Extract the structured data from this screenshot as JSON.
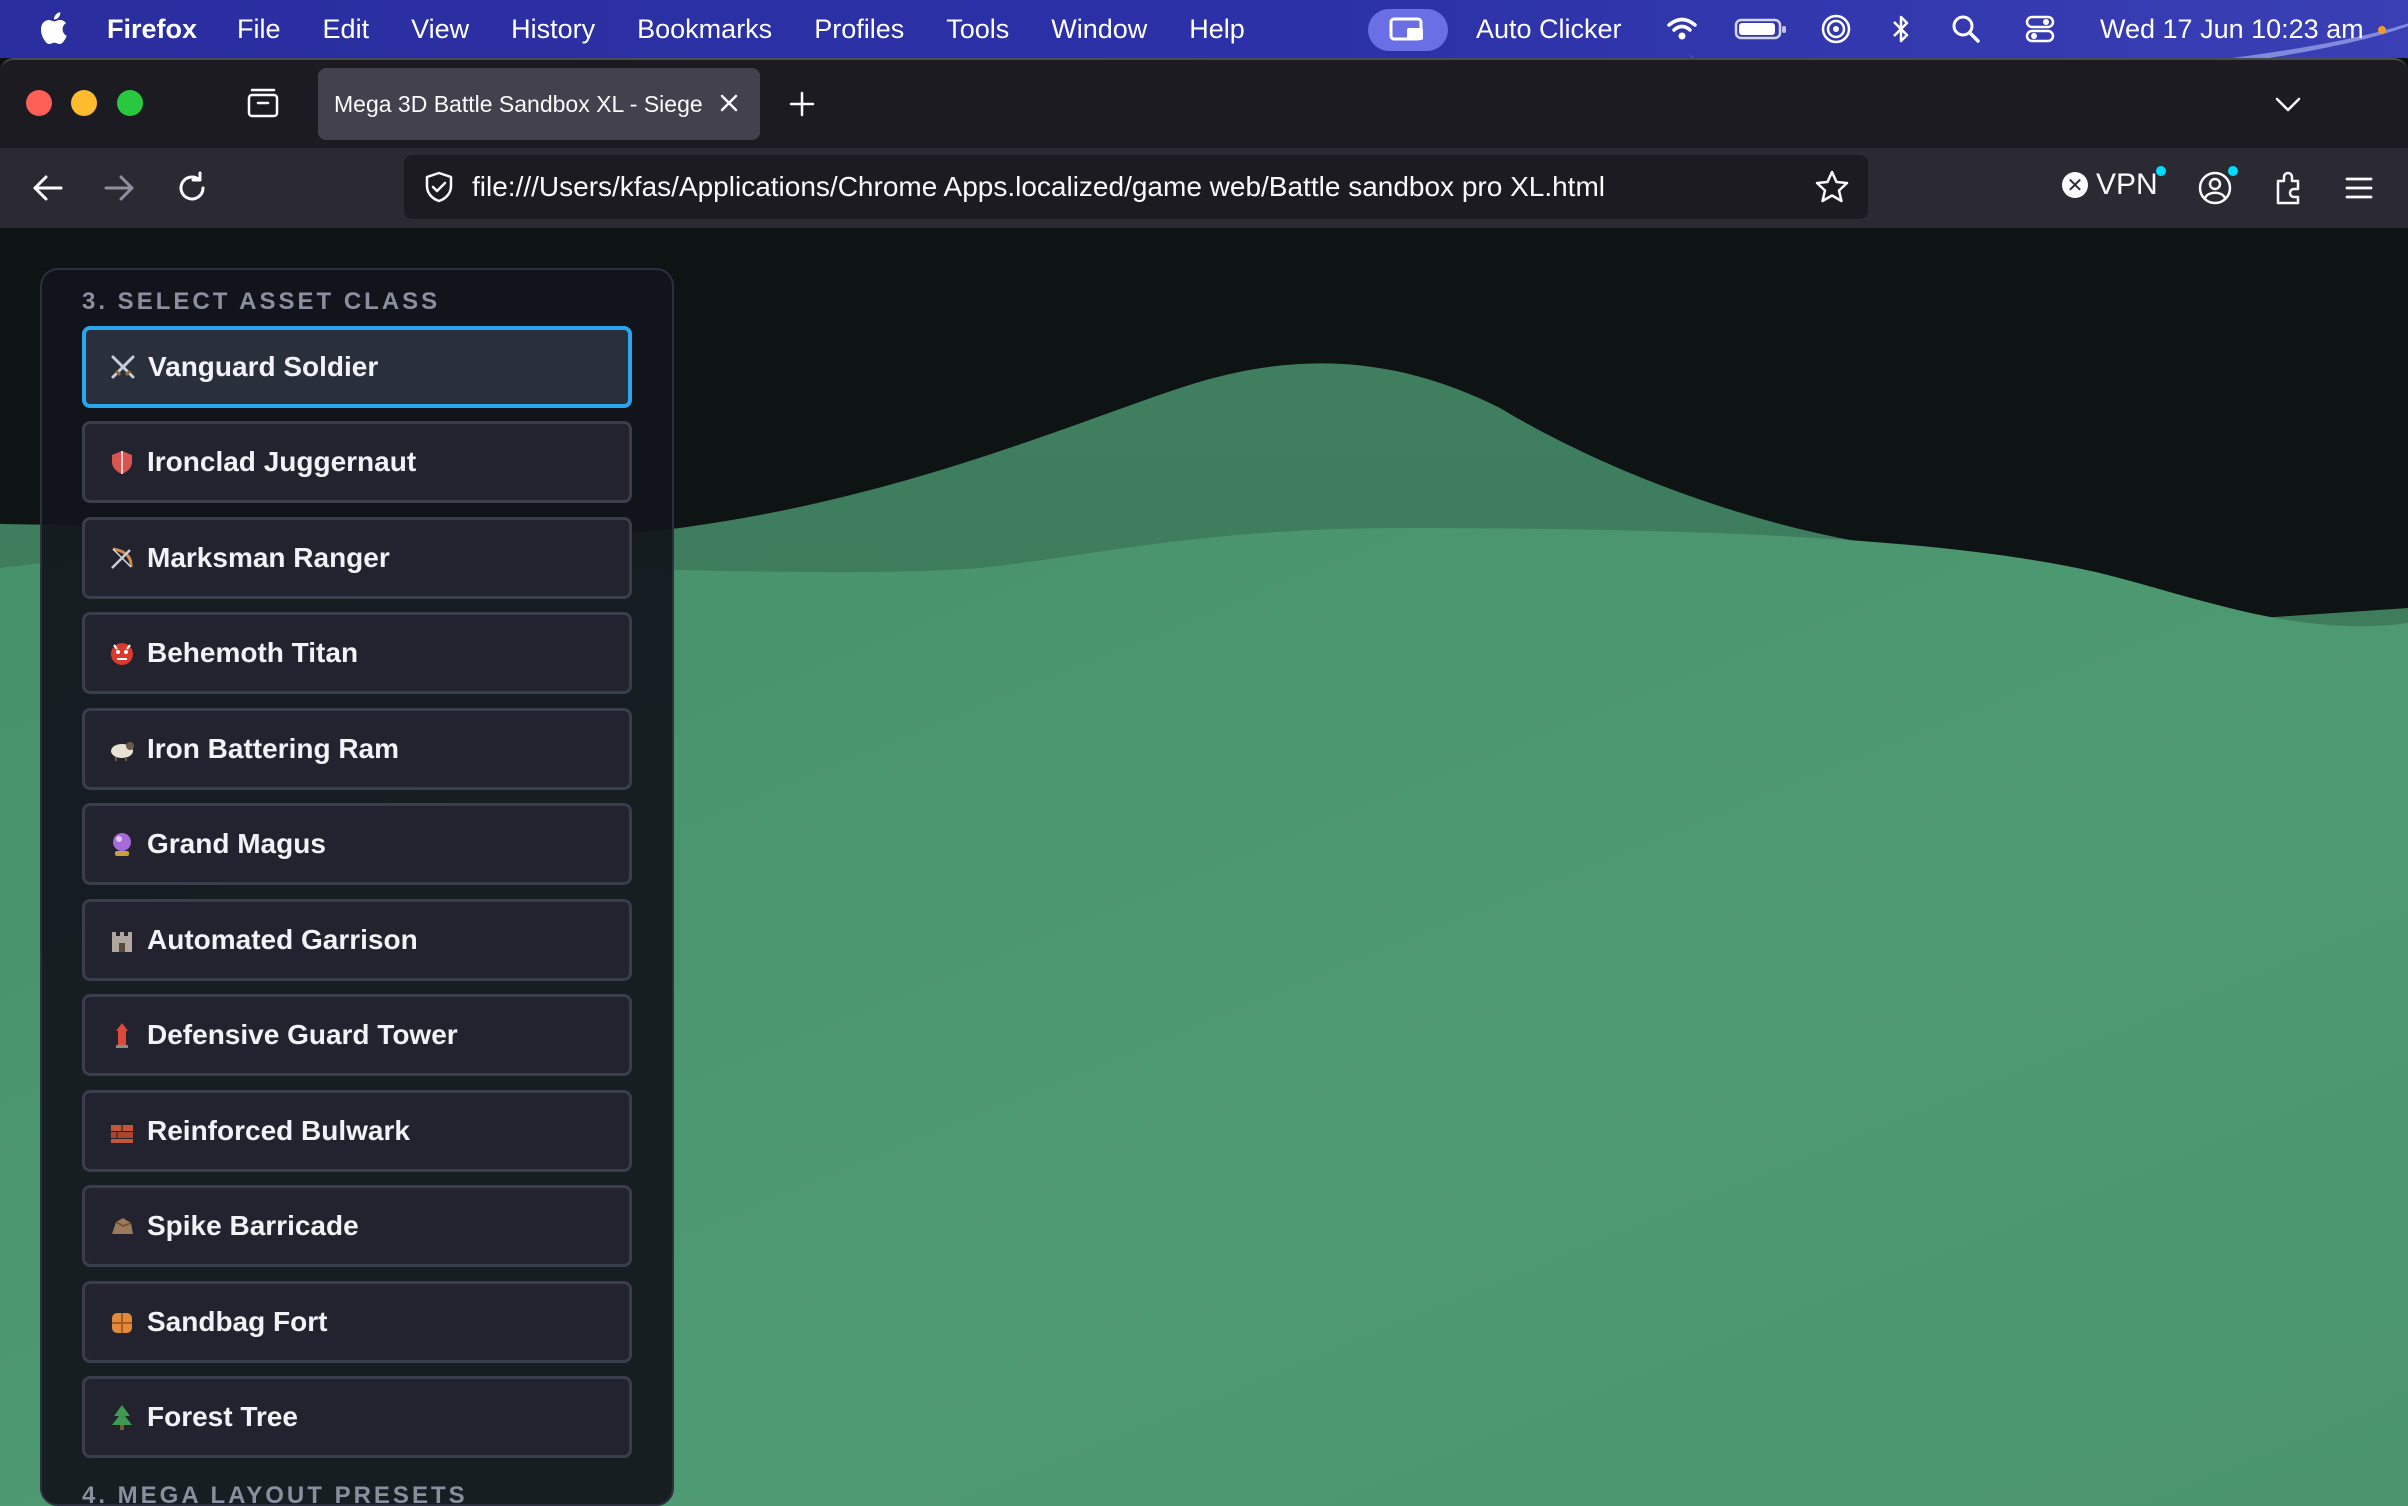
{
  "menubar": {
    "app_name": "Firefox",
    "items": [
      "File",
      "Edit",
      "View",
      "History",
      "Bookmarks",
      "Profiles",
      "Tools",
      "Window",
      "Help"
    ],
    "auto_clicker_label": "Auto Clicker",
    "clock": "Wed 17 Jun  10:23 am"
  },
  "browser": {
    "tab_title": "Mega 3D Battle Sandbox XL - Siege",
    "url": "file:///Users/kfas/Applications/Chrome Apps.localized/game web/Battle sandbox pro XL.html",
    "vpn_label": "VPN"
  },
  "panel": {
    "section_title": "3. SELECT ASSET CLASS",
    "next_section_title": "4. MEGA LAYOUT PRESETS",
    "selected_index": 0,
    "assets": [
      {
        "label": "Vanguard Soldier",
        "icon": "crossed-swords-icon",
        "color": "#c9ccd6"
      },
      {
        "label": "Ironclad Juggernaut",
        "icon": "shield-icon",
        "color": "#d9534f"
      },
      {
        "label": "Marksman Ranger",
        "icon": "bow-and-arrow-icon",
        "color": "#c98a4a"
      },
      {
        "label": "Behemoth Titan",
        "icon": "ogre-icon",
        "color": "#d93a2b"
      },
      {
        "label": "Iron Battering Ram",
        "icon": "ram-icon",
        "color": "#e8e2d4"
      },
      {
        "label": "Grand Magus",
        "icon": "crystal-ball-icon",
        "color": "#a66ad9"
      },
      {
        "label": "Automated Garrison",
        "icon": "castle-icon",
        "color": "#b0a8a0"
      },
      {
        "label": "Defensive Guard Tower",
        "icon": "tower-icon",
        "color": "#d94a3a"
      },
      {
        "label": "Reinforced Bulwark",
        "icon": "bricks-icon",
        "color": "#c0563a"
      },
      {
        "label": "Spike Barricade",
        "icon": "rock-icon",
        "color": "#9a7a5a"
      },
      {
        "label": "Sandbag Fort",
        "icon": "sandbag-icon",
        "color": "#e08a3a"
      },
      {
        "label": "Forest Tree",
        "icon": "evergreen-tree-icon",
        "color": "#3f9a4f"
      }
    ]
  },
  "colors": {
    "accent": "#2aa6f0",
    "terrain": "#4b946e",
    "sky": "#0e1413"
  }
}
